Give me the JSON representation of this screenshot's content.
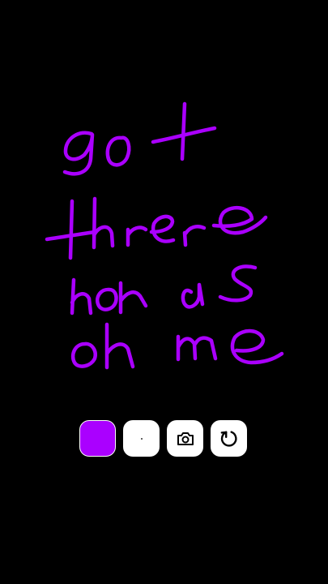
{
  "canvas": {
    "background": "#000000",
    "handwriting_text": "got there nonas oh me",
    "stroke_color": "#aa00ff"
  },
  "toolbar": {
    "color_swatch": {
      "icon": "color-swatch",
      "color": "#aa00ff"
    },
    "brush_size": {
      "icon": "brush-size-dot"
    },
    "camera": {
      "icon": "camera-icon"
    },
    "undo": {
      "icon": "undo-icon"
    }
  }
}
